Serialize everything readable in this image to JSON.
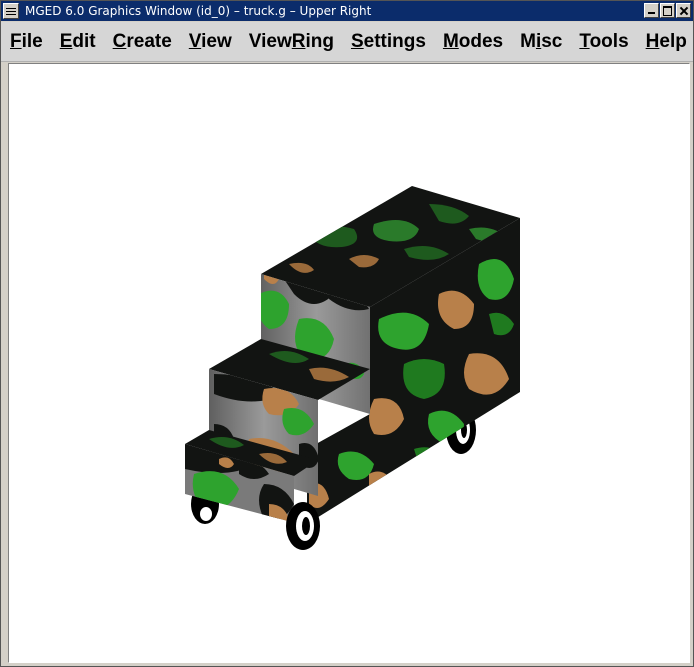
{
  "window": {
    "title": "MGED 6.0 Graphics Window (id_0) – truck.g – Upper Right"
  },
  "menubar": {
    "items": [
      {
        "label": "File",
        "underline": "F",
        "rest": "ile"
      },
      {
        "label": "Edit",
        "underline": "E",
        "rest": "dit"
      },
      {
        "label": "Create",
        "underline": "C",
        "rest": "reate"
      },
      {
        "label": "View",
        "underline": "V",
        "rest": "iew"
      },
      {
        "label": "ViewRing",
        "pre": "View",
        "underline": "R",
        "rest": "ing"
      },
      {
        "label": "Settings",
        "underline": "S",
        "rest": "ettings"
      },
      {
        "label": "Modes",
        "underline": "M",
        "rest": "odes"
      },
      {
        "label": "Misc",
        "pre": "M",
        "underline": "i",
        "rest": "sc"
      },
      {
        "label": "Tools",
        "underline": "T",
        "rest": "ools"
      },
      {
        "label": "Help",
        "underline": "H",
        "rest": "elp"
      }
    ]
  },
  "icons": {
    "system_menu": "system-menu-icon",
    "minimize": "minimize-icon",
    "maximize": "maximize-icon",
    "close": "close-icon"
  },
  "colors": {
    "titlebar": "#0b2c6b",
    "camo_black": "#121412",
    "camo_green": "#2ea32e",
    "camo_brown": "#b8804a",
    "gray_face": "#7a7a7a"
  }
}
